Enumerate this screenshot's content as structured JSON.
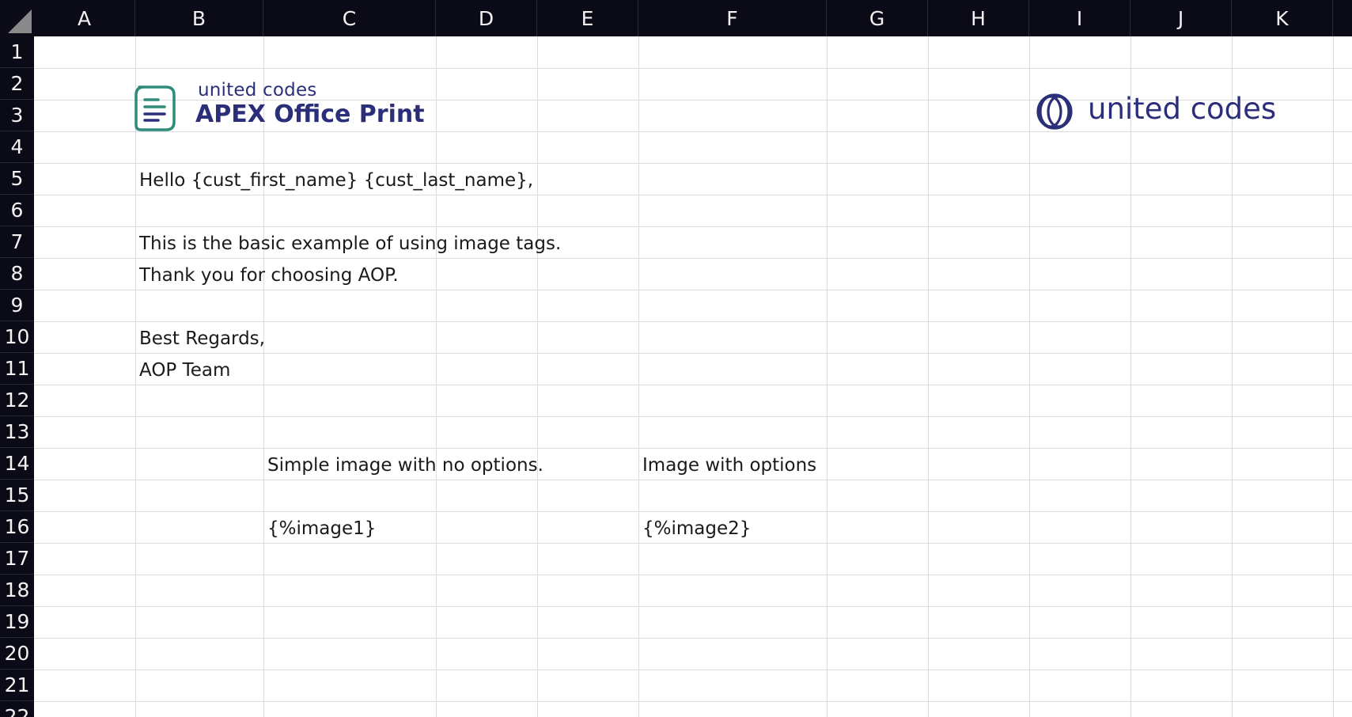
{
  "columns": [
    "A",
    "B",
    "C",
    "D",
    "E",
    "F",
    "G",
    "H",
    "I",
    "J",
    "K"
  ],
  "rows": [
    "1",
    "2",
    "3",
    "4",
    "5",
    "6",
    "7",
    "8",
    "9",
    "10",
    "11",
    "12",
    "13",
    "14",
    "15",
    "16",
    "17",
    "18",
    "19",
    "20",
    "21",
    "22"
  ],
  "header_logo": {
    "icon": "document-lines-icon",
    "brand_small": "united codes",
    "product_name": "APEX Office Print"
  },
  "right_logo": {
    "icon": "interlocking-rings-icon",
    "text": "united codes",
    "color": "#2b2f7a"
  },
  "cells": {
    "B5": "Hello {cust_first_name} {cust_last_name},",
    "B7": "This is the basic example of using image tags.",
    "B8": "Thank you for choosing AOP.",
    "B10": "Best Regards,",
    "B11": "AOP Team",
    "C14": "Simple image with no options.",
    "F14": "Image with options",
    "C16": "{%image1}",
    "F16": "{%image2}"
  },
  "colors": {
    "header_bg": "#0b0b17",
    "header_text": "#f2f2f2",
    "gridline": "#dcdcdc",
    "brand": "#2b2f7a",
    "logo_accent": "#2e8b7a"
  }
}
